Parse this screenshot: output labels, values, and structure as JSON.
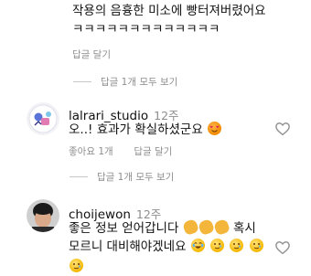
{
  "top_comment": {
    "line1": "작용의 음흉한 미소에 빵터져버렸어요",
    "line2": "ㅋㅋㅋㅋㅋㅋㅋㅋㅋㅋㅋㅋㅋ",
    "reply_label": "답글 달기"
  },
  "top_replies_toggle": "답글 1개 모두 보기",
  "comments": [
    {
      "username": "lalrari_studio",
      "time": "12주",
      "text": "오..! 효과가 확실하셨군요",
      "like_label": "좋아요 1개",
      "reply_label": "답글 달기",
      "replies_toggle": "답글 1개 모두 보기"
    },
    {
      "username": "choijewon",
      "time": "12주",
      "text_line1": "좋은 정보 얻어갑니다",
      "text_line1_end": "혹시",
      "text_line2": "모르니 대비해야겠네요"
    }
  ],
  "icons": {
    "heart": "heart-outline-icon",
    "emoji_heart_eyes": "smiling-face-with-heart-eyes",
    "emoji_clap": "clapping-hands",
    "emoji_laugh": "face-with-tears-of-joy",
    "emoji_tear": "smiling-face-with-tear"
  },
  "colors": {
    "meta": "#8e8e8e",
    "text": "#111111"
  }
}
